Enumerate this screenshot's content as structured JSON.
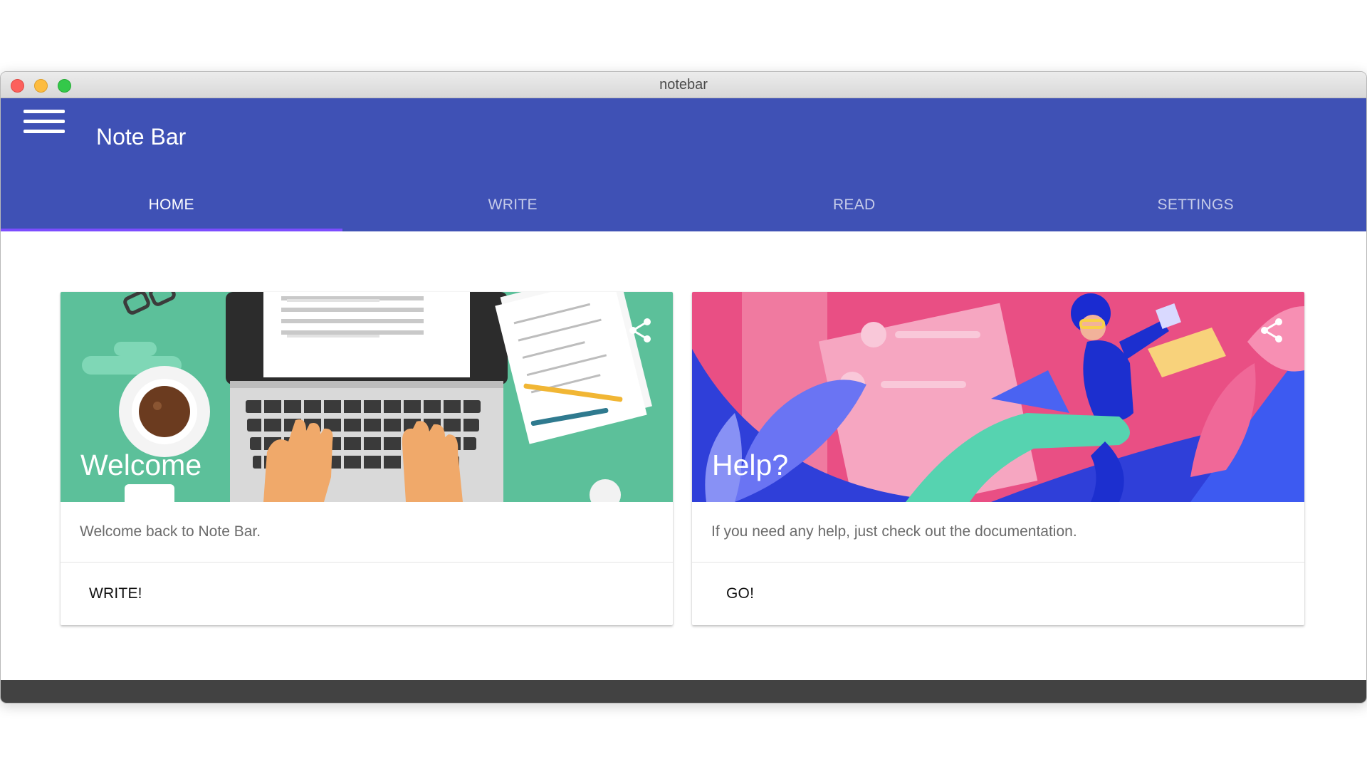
{
  "window": {
    "title": "notebar"
  },
  "appbar": {
    "title": "Note Bar"
  },
  "tabs": [
    {
      "label": "HOME",
      "active": true
    },
    {
      "label": "WRITE",
      "active": false
    },
    {
      "label": "READ",
      "active": false
    },
    {
      "label": "SETTINGS",
      "active": false
    }
  ],
  "cards": [
    {
      "title": "Welcome",
      "text": "Welcome back to Note Bar.",
      "button": "WRITE!",
      "image": "laptop-desk-illustration"
    },
    {
      "title": "Help?",
      "text": "If you need any help, just check out the documentation.",
      "button": "GO!",
      "image": "abstract-person-illustration"
    }
  ],
  "colors": {
    "primary": "#3f51b5",
    "accent": "#7c4dff",
    "welcome_bg": "#5cc09a",
    "help_bg": "#e94f84",
    "bottom_bar": "#424242"
  },
  "icons": [
    "menu-icon",
    "share-icon"
  ]
}
